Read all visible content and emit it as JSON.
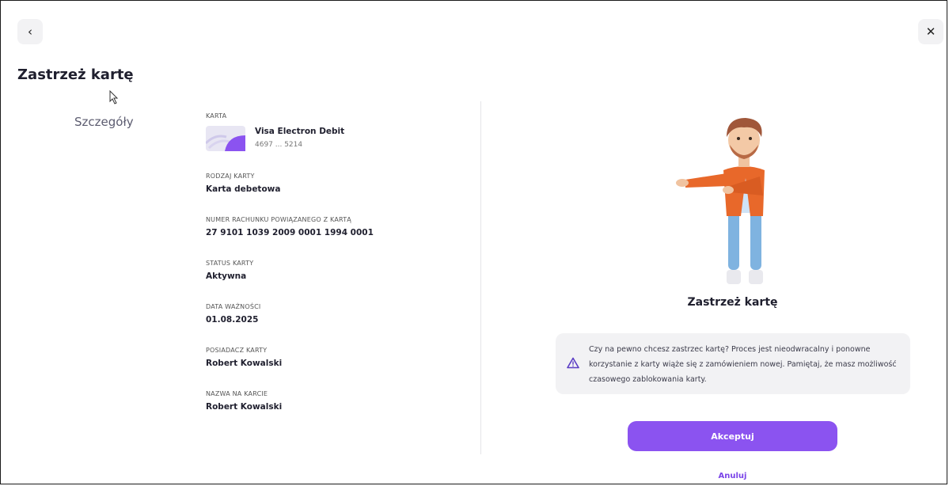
{
  "header": {
    "back_icon": "‹",
    "close_icon": "✕",
    "title": "Zastrzeż kartę"
  },
  "sidebar": {
    "section_label": "Szczegóły"
  },
  "details": {
    "card": {
      "label": "KARTA",
      "name": "Visa Electron Debit",
      "number": "4697 ... 5214"
    },
    "fields": [
      {
        "label": "RODZAJ KARTY",
        "value": "Karta debetowa"
      },
      {
        "label": "NUMER RACHUNKU POWIĄZANEGO Z KARTĄ",
        "value": "27 9101 1039 2009 0001 1994 0001"
      },
      {
        "label": "STATUS KARTY",
        "value": "Aktywna"
      },
      {
        "label": "DATA WAŻNOŚCI",
        "value": "01.08.2025"
      },
      {
        "label": "POSIADACZ KARTY",
        "value": "Robert Kowalski"
      },
      {
        "label": "NAZWA NA KARCIE",
        "value": "Robert Kowalski"
      }
    ]
  },
  "confirm": {
    "title": "Zastrzeż kartę",
    "notice": "Czy na pewno chcesz zastrzec kartę? Proces jest nieodwracalny i ponowne korzystanie z karty wiąże się z zamówieniem nowej. Pamiętaj, że masz możliwość czasowego zablokowania karty.",
    "accept_label": "Akceptuj",
    "cancel_label": "Anuluj"
  },
  "colors": {
    "accent": "#8b53f0",
    "link": "#7a44e8",
    "notice_bg": "#f2f2f4"
  }
}
